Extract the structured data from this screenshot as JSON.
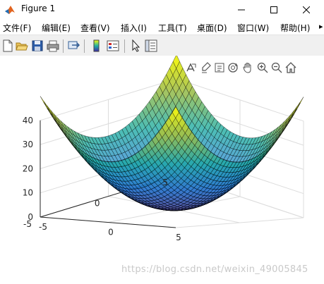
{
  "window": {
    "title": "Figure 1"
  },
  "menu": [
    {
      "label": "文件(F)"
    },
    {
      "label": "编辑(E)"
    },
    {
      "label": "查看(V)"
    },
    {
      "label": "插入(I)"
    },
    {
      "label": "工具(T)"
    },
    {
      "label": "桌面(D)"
    },
    {
      "label": "窗口(W)"
    },
    {
      "label": "帮助(H)"
    }
  ],
  "toolbar_icons": [
    "new-figure-icon",
    "open-file-icon",
    "save-icon",
    "print-icon",
    "link-plot-icon",
    "insert-colorbar-icon",
    "insert-legend-icon",
    "edit-plot-arrow-icon",
    "property-inspector-icon"
  ],
  "axes_toolbar_icons": [
    "export-icon",
    "brush-icon",
    "data-tips-icon",
    "rotate-3d-icon",
    "pan-hand-icon",
    "zoom-in-icon",
    "zoom-out-icon",
    "home-view-icon"
  ],
  "chart_data": {
    "type": "surface",
    "function": "z = x^2 + y^2",
    "x_range": [
      -5,
      5
    ],
    "y_range": [
      -5,
      5
    ],
    "zlim": [
      0,
      40
    ],
    "z_max": 50,
    "colormap": "parula",
    "edge_color": "#000000",
    "z_ticks": [
      "0",
      "10",
      "20",
      "30",
      "40"
    ],
    "x_ticks": [
      "-5",
      "0",
      "5"
    ],
    "y_ticks": [
      "-5",
      "0",
      "5"
    ],
    "grid": true
  },
  "watermark": "https://blog.csdn.net/weixin_49005845"
}
